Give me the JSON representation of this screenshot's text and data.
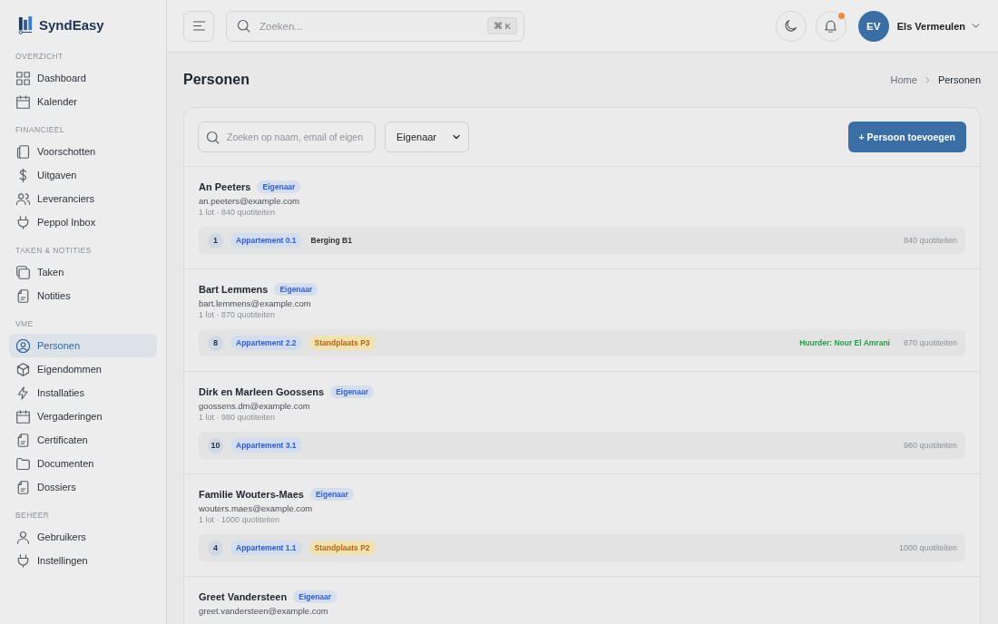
{
  "sidebar": {
    "brand": "SyndEasy",
    "sections": [
      {
        "label": "OVERZICHT",
        "items": [
          {
            "label": "Dashboard",
            "selected": false
          },
          {
            "label": "Kalender",
            "selected": false
          }
        ]
      },
      {
        "label": "FINANCIEEL",
        "items": [
          {
            "label": "Voorschotten",
            "selected": false
          },
          {
            "label": "Uitgaven",
            "selected": false
          },
          {
            "label": "Leveranciers",
            "selected": false
          },
          {
            "label": "Peppol Inbox",
            "selected": false
          }
        ]
      },
      {
        "label": "TAKEN & NOTITIES",
        "items": [
          {
            "label": "Taken",
            "selected": false
          },
          {
            "label": "Notities",
            "selected": false
          }
        ]
      },
      {
        "label": "VME",
        "items": [
          {
            "label": "Personen",
            "selected": true
          },
          {
            "label": "Eigendommen",
            "selected": false
          },
          {
            "label": "Installaties",
            "selected": false
          },
          {
            "label": "Vergaderingen",
            "selected": false
          },
          {
            "label": "Certificaten",
            "selected": false
          },
          {
            "label": "Documenten",
            "selected": false
          },
          {
            "label": "Dossiers",
            "selected": false
          }
        ]
      },
      {
        "label": "BEHEER",
        "items": [
          {
            "label": "Gebruikers",
            "selected": false
          },
          {
            "label": "Instellingen",
            "selected": false
          }
        ]
      }
    ]
  },
  "top_bar": {
    "search": {
      "placeholder": "Zoeken...",
      "shortcut": "⌘ K"
    },
    "notifications": {
      "unread": true
    },
    "user": {
      "initials": "EV",
      "name": "Els Vermeulen"
    }
  },
  "page": {
    "title": "Personen",
    "breadcrumb": [
      {
        "label": "Home",
        "current": false
      },
      {
        "label": "Personen",
        "current": true
      }
    ]
  },
  "toolbar": {
    "search": {
      "placeholder": "Zoeken op naam, email of eigen"
    },
    "role_filter": {
      "value": "Eigenaar"
    },
    "add_button": "+ Persoon toevoegen"
  },
  "persons": [
    {
      "name": "An Peeters",
      "role": "Eigenaar",
      "email": "an.peeters@example.com",
      "summary": "1 lot · 840 quotiteiten",
      "lots": [
        {
          "number": "1",
          "units": [
            {
              "label": "Appartement 0.1",
              "kind": "apartment"
            },
            {
              "label": "Berging B1",
              "kind": "storage"
            }
          ],
          "shares": "840 quotiteiten"
        }
      ]
    },
    {
      "name": "Bart Lemmens",
      "role": "Eigenaar",
      "email": "bart.lemmens@example.com",
      "summary": "1 lot · 870 quotiteiten",
      "lots": [
        {
          "number": "8",
          "units": [
            {
              "label": "Appartement 2.2",
              "kind": "apartment"
            },
            {
              "label": "Standplaats P3",
              "kind": "parking"
            }
          ],
          "tenant": "Huurder: Nour El Amrani",
          "shares": "870 quotiteiten"
        }
      ]
    },
    {
      "name": "Dirk en Marleen Goossens",
      "role": "Eigenaar",
      "email": "goossens.dm@example.com",
      "summary": "1 lot · 980 quotiteiten",
      "lots": [
        {
          "number": "10",
          "units": [
            {
              "label": "Appartement 3.1",
              "kind": "apartment"
            }
          ],
          "shares": "980 quotiteiten"
        }
      ]
    },
    {
      "name": "Familie Wouters-Maes",
      "role": "Eigenaar",
      "email": "wouters.maes@example.com",
      "summary": "1 lot · 1000 quotiteiten",
      "lots": [
        {
          "number": "4",
          "units": [
            {
              "label": "Appartement 1.1",
              "kind": "apartment"
            },
            {
              "label": "Standplaats P2",
              "kind": "parking"
            }
          ],
          "shares": "1000 quotiteiten"
        }
      ]
    },
    {
      "name": "Greet Vandersteen",
      "role": "Eigenaar",
      "email": "greet.vandersteen@example.com"
    }
  ]
}
